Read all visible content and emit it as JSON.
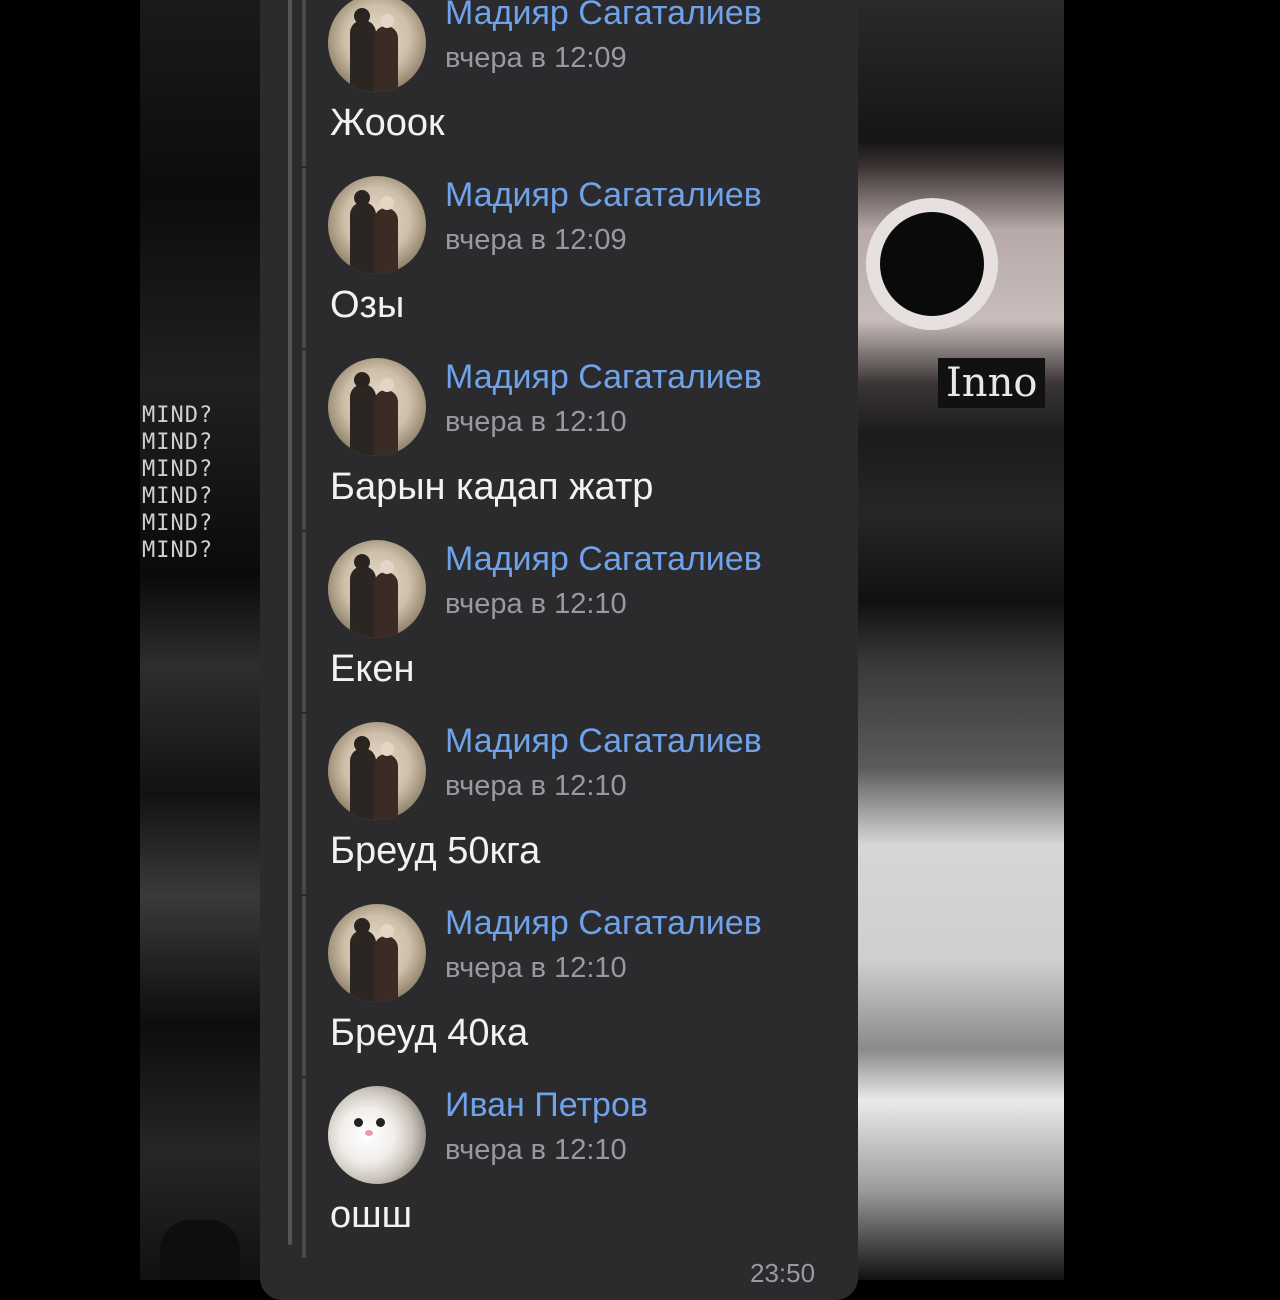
{
  "wallpaper": {
    "left_words": [
      "MIND?",
      "MIND?",
      "MIND?",
      "MIND?",
      "MIND?",
      "MIND?"
    ],
    "right_word": "Inno"
  },
  "messages": [
    {
      "author": "Мадияр Сагаталиев",
      "time": "вчера в 12:09",
      "text": "Жооок",
      "avatar": "couple-photo"
    },
    {
      "author": "Мадияр Сагаталиев",
      "time": "вчера в 12:09",
      "text": "Озы",
      "avatar": "couple-photo"
    },
    {
      "author": "Мадияр Сагаталиев",
      "time": "вчера в 12:10",
      "text": "Барын кадап жатр",
      "avatar": "couple-photo"
    },
    {
      "author": "Мадияр Сагаталиев",
      "time": "вчера в 12:10",
      "text": "Екен",
      "avatar": "couple-photo"
    },
    {
      "author": "Мадияр Сагаталиев",
      "time": "вчера в 12:10",
      "text": "Бреуд 50кга",
      "avatar": "couple-photo"
    },
    {
      "author": "Мадияр Сагаталиев",
      "time": "вчера в 12:10",
      "text": "Бреуд 40ка",
      "avatar": "couple-photo"
    },
    {
      "author": "Иван Петров",
      "time": "вчера в 12:10",
      "text": "ошш",
      "avatar": "cat-photo"
    }
  ],
  "footer_time": "23:50",
  "colors": {
    "panel": "#2b2b2d",
    "author": "#6fa2e8",
    "timestamp": "#9a9a9e",
    "text": "#f2f2f2"
  }
}
